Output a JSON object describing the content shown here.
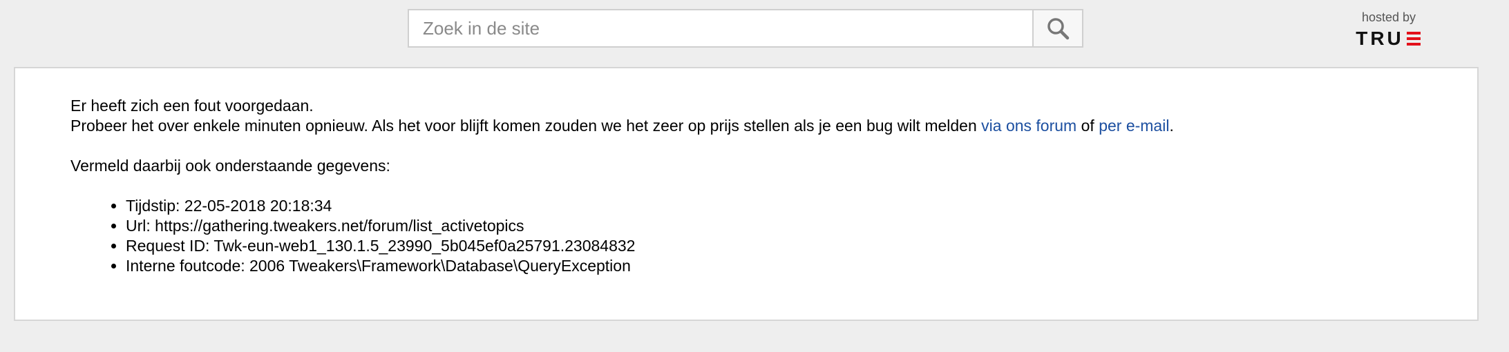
{
  "search": {
    "placeholder": "Zoek in de site"
  },
  "icons": {
    "search": "search-icon",
    "logo": "true-logo-icon"
  },
  "hosting": {
    "label": "hosted by",
    "logo_text": "TRU",
    "logo_accent_color": "#e3101a"
  },
  "error": {
    "heading": "Er heeft zich een fout voorgedaan.",
    "message_before": "Probeer het over enkele minuten opnieuw. Als het voor blijft komen zouden we het zeer op prijs stellen als je een bug wilt melden ",
    "forum_link": "via ons forum",
    "middle": " of ",
    "email_link": "per e-mail",
    "end": ".",
    "details_intro": "Vermeld daarbij ook onderstaande gegevens:",
    "details": [
      "Tijdstip: 22-05-2018 20:18:34",
      "Url: https://gathering.tweakers.net/forum/list_activetopics",
      "Request ID: Twk-eun-web1_130.1.5_23990_5b045ef0a25791.23084832",
      "Interne foutcode: 2006 Tweakers\\Framework\\Database\\QueryException"
    ]
  },
  "colors": {
    "background": "#eeeeee",
    "link": "#1c4fa0",
    "panel": "#ffffff"
  }
}
